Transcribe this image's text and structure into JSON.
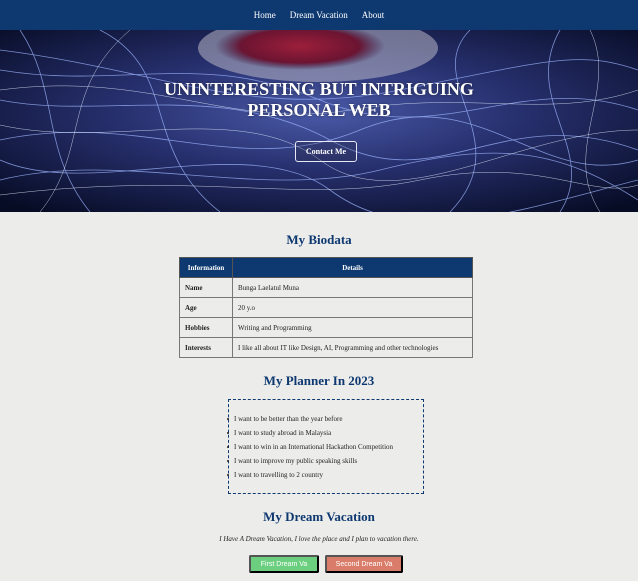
{
  "nav": {
    "items": [
      "Home",
      "Dream Vacation",
      "About"
    ]
  },
  "hero": {
    "title_line1": "UNINTERESTING BUT INTRIGUING",
    "title_line2": "PERSONAL WEB",
    "contact_label": "Contact Me"
  },
  "biodata": {
    "title": "My Biodata",
    "headers": [
      "Information",
      "Details"
    ],
    "rows": [
      {
        "key": "Name",
        "value": "Bunga Laelatul Muna"
      },
      {
        "key": "Age",
        "value": "20 y.o"
      },
      {
        "key": "Hobbies",
        "value": "Writing and Programming"
      },
      {
        "key": "Interests",
        "value": "I like all about IT like Design, AI, Programming and other technologies"
      }
    ]
  },
  "planner": {
    "title": "My Planner In 2023",
    "items": [
      "I want to be better than the year before",
      "I want to study abroad in Malaysia",
      "I want to win in an International Hackathon Competition",
      "I want to improve my public speaking skills",
      "I want to travelling to 2 country"
    ]
  },
  "vacation": {
    "title": "My Dream Vacation",
    "text": "I Have A Dream Vacation, I love the place and I plan to vacation there.",
    "button1": "First Dream Va",
    "button2": "Second Dream Va"
  },
  "colors": {
    "navbar": "#0d3870",
    "title": "#0d3870",
    "button1": "#6ccf80",
    "button2": "#d97d6a"
  }
}
